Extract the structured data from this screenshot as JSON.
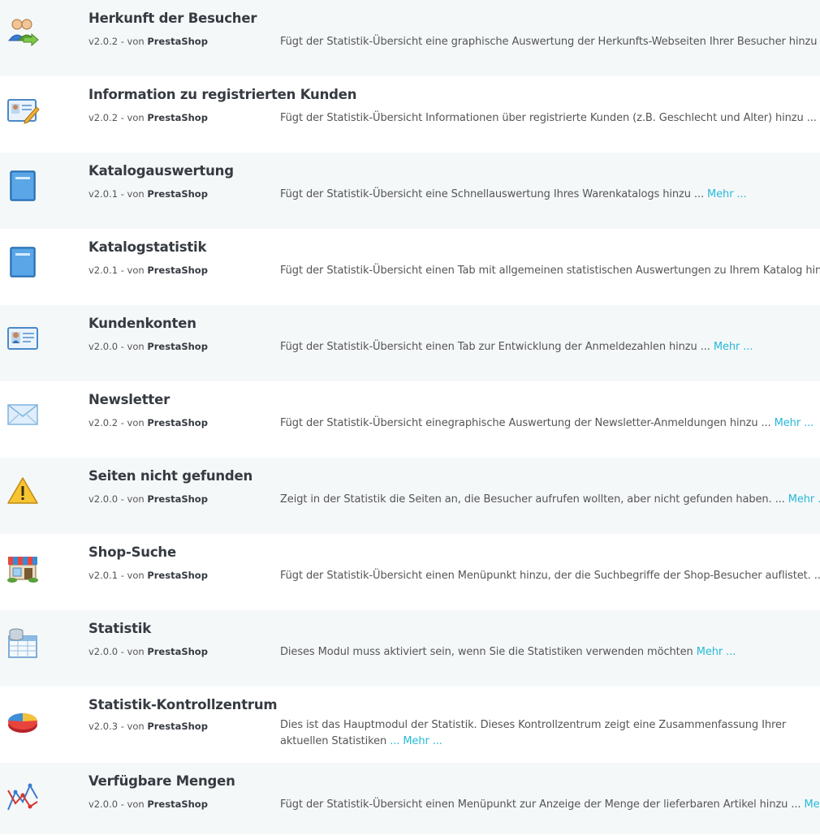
{
  "modules": [
    {
      "name": "Herkunft der Besucher",
      "version": "v2.0.2 - von",
      "author": "PrestaShop",
      "description": "Fügt der Statistik-Übersicht eine graphische Auswertung der Herkunfts-Webseiten Ihrer Besucher hinzu",
      "more": "",
      "icon": "users-arrow-icon"
    },
    {
      "name": "Information zu registrierten Kunden",
      "version": "v2.0.2 - von",
      "author": "PrestaShop",
      "description": "Fügt der Statistik-Übersicht Informationen über registrierte Kunden (z.B. Geschlecht und Alter) hinzu ...",
      "more": "",
      "icon": "id-card-pen-icon"
    },
    {
      "name": "Katalogauswertung",
      "version": "v2.0.1 - von",
      "author": "PrestaShop",
      "description": "Fügt der Statistik-Übersicht eine Schnellauswertung Ihres Warenkatalogs hinzu ...",
      "more": "Mehr ...",
      "icon": "book-icon"
    },
    {
      "name": "Katalogstatistik",
      "version": "v2.0.1 - von",
      "author": "PrestaShop",
      "description": "Fügt der Statistik-Übersicht einen Tab mit allgemeinen statistischen Auswertungen zu Ihrem Katalog hinzu",
      "more": "",
      "icon": "book-icon"
    },
    {
      "name": "Kundenkonten",
      "version": "v2.0.0 - von",
      "author": "PrestaShop",
      "description": "Fügt der Statistik-Übersicht einen Tab zur Entwicklung der Anmeldezahlen hinzu ...",
      "more": "Mehr ...",
      "icon": "id-card-icon"
    },
    {
      "name": "Newsletter",
      "version": "v2.0.2 - von",
      "author": "PrestaShop",
      "description": "Fügt der Statistik-Übersicht einegraphische Auswertung der Newsletter-Anmeldungen hinzu ...",
      "more": "Mehr ...",
      "icon": "envelope-icon"
    },
    {
      "name": "Seiten nicht gefunden",
      "version": "v2.0.0 - von",
      "author": "PrestaShop",
      "description": "Zeigt in der Statistik die Seiten an, die Besucher aufrufen wollten, aber nicht gefunden haben. ...",
      "more": "Mehr ...",
      "icon": "warning-icon"
    },
    {
      "name": "Shop-Suche",
      "version": "v2.0.1 - von",
      "author": "PrestaShop",
      "description": "Fügt der Statistik-Übersicht einen Menüpunkt hinzu, der die Suchbegriffe der Shop-Besucher auflistet. ...",
      "more": "",
      "icon": "shop-icon"
    },
    {
      "name": "Statistik",
      "version": "v2.0.0 - von",
      "author": "PrestaShop",
      "description": "Dieses Modul muss aktiviert sein, wenn Sie die Statistiken verwenden möchten",
      "more": "Mehr ...",
      "icon": "database-table-icon"
    },
    {
      "name": "Statistik-Kontrollzentrum",
      "version": "v2.0.3 - von",
      "author": "PrestaShop",
      "description": "Dies ist das Hauptmodul der Statistik. Dieses Kontrollzentrum zeigt eine Zusammenfassung Ihrer aktuellen Statistiken",
      "more": "... Mehr ...",
      "icon": "pie-chart-icon"
    },
    {
      "name": "Verfügbare Mengen",
      "version": "v2.0.0 - von",
      "author": "PrestaShop",
      "description": "Fügt der Statistik-Übersicht einen Menüpunkt zur Anzeige der Menge der lieferbaren Artikel hinzu ...",
      "more": "Mehr ...",
      "icon": "line-graph-icon"
    }
  ]
}
